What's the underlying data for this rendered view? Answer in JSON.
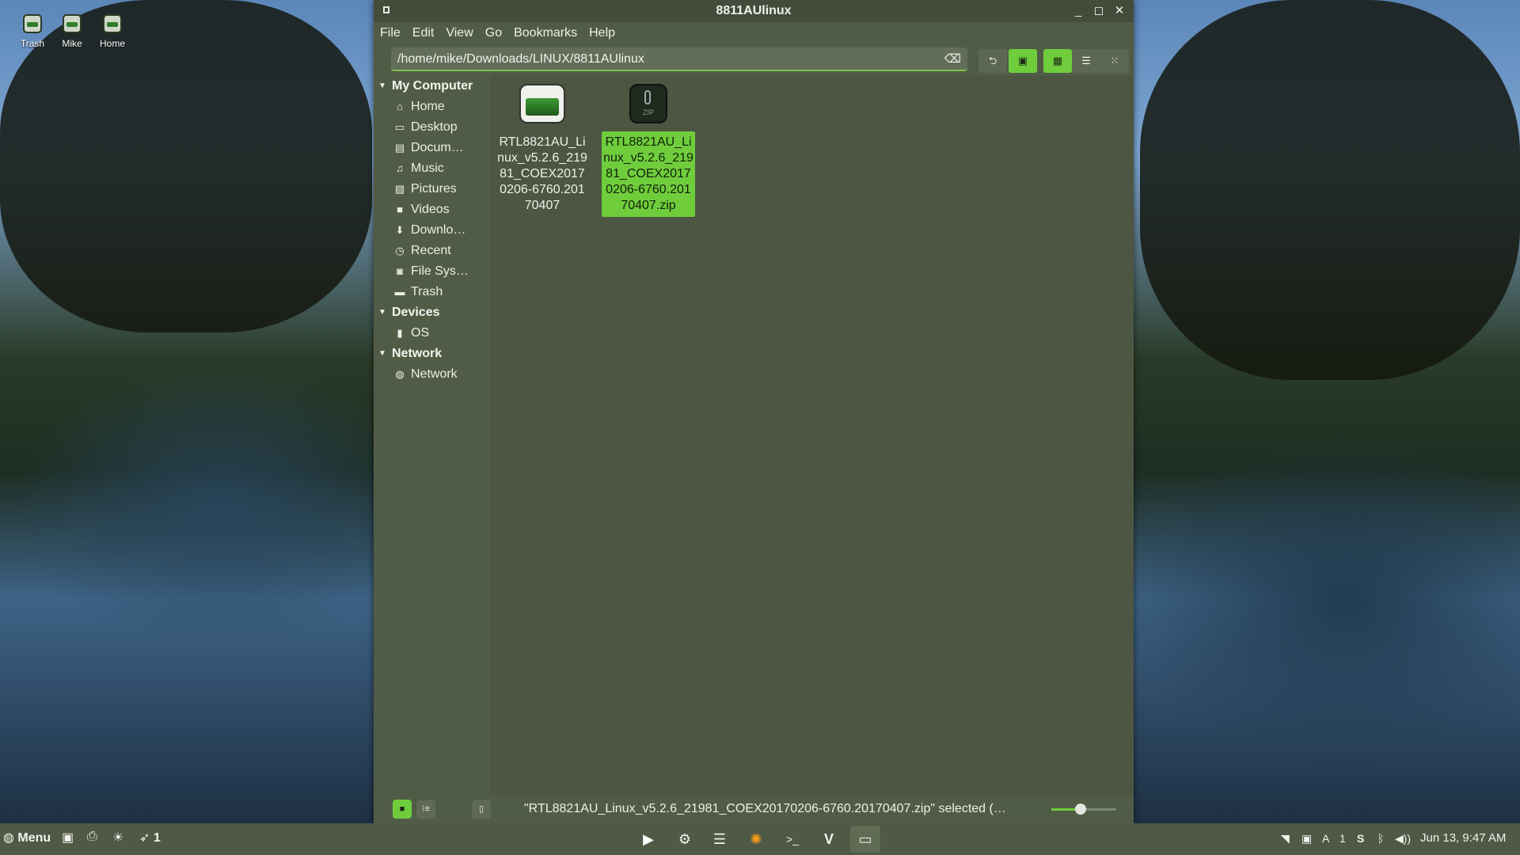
{
  "desktop": {
    "icons": [
      {
        "label": "Trash",
        "icon": "trash-icon"
      },
      {
        "label": "Mike",
        "icon": "drive-icon"
      },
      {
        "label": "Home",
        "icon": "home-folder-icon"
      }
    ]
  },
  "window": {
    "title": "8811AUlinux",
    "controls": {
      "minimize": "_",
      "maximize": "◻",
      "close": "✕"
    }
  },
  "menubar": [
    "File",
    "Edit",
    "View",
    "Go",
    "Bookmarks",
    "Help"
  ],
  "toolbar": {
    "path": "/home/mike/Downloads/LINUX/8811AUlinux",
    "buttons": [
      {
        "name": "toggle-location-icon",
        "glyph": "⮌",
        "active": false
      },
      {
        "name": "image-view-icon",
        "glyph": "▣",
        "active": true
      },
      {
        "name": "icon-view-icon",
        "glyph": "▦",
        "active": true
      },
      {
        "name": "list-view-icon",
        "glyph": "☰",
        "active": false
      },
      {
        "name": "compact-view-icon",
        "glyph": "⁙",
        "active": false
      }
    ]
  },
  "sidebar": {
    "sections": [
      {
        "title": "My Computer",
        "items": [
          {
            "label": "Home",
            "icon": "home-icon",
            "glyph": "⌂"
          },
          {
            "label": "Desktop",
            "icon": "desktop-icon",
            "glyph": "▭"
          },
          {
            "label": "Docum…",
            "icon": "document-icon",
            "glyph": "▤"
          },
          {
            "label": "Music",
            "icon": "music-icon",
            "glyph": "♫"
          },
          {
            "label": "Pictures",
            "icon": "pictures-icon",
            "glyph": "▨"
          },
          {
            "label": "Videos",
            "icon": "videos-icon",
            "glyph": "■"
          },
          {
            "label": "Downlo…",
            "icon": "download-icon",
            "glyph": "⬇"
          },
          {
            "label": "Recent",
            "icon": "recent-icon",
            "glyph": "◷"
          },
          {
            "label": "File Sys…",
            "icon": "filesystem-icon",
            "glyph": "◙"
          },
          {
            "label": "Trash",
            "icon": "trash-icon",
            "glyph": "▬"
          }
        ]
      },
      {
        "title": "Devices",
        "items": [
          {
            "label": "OS",
            "icon": "drive-icon",
            "glyph": "▮"
          }
        ]
      },
      {
        "title": "Network",
        "items": [
          {
            "label": "Network",
            "icon": "network-icon",
            "glyph": "◍"
          }
        ]
      }
    ]
  },
  "files": [
    {
      "name": "RTL8821AU_Linux_v5.2.6_21981_COEX20170206-6760.20170407",
      "type": "folder",
      "selected": false
    },
    {
      "name": "RTL8821AU_Linux_v5.2.6_21981_COEX20170206-6760.20170407.zip",
      "type": "zip",
      "selected": true,
      "badge": "ZIP"
    }
  ],
  "statusbar": {
    "text": "\"RTL8821AU_Linux_v5.2.6_21981_COEX20170206-6760.20170407.zip\" selected (…",
    "zoom": 0.45
  },
  "taskbar": {
    "menu_label": "Menu",
    "notify_count": "1",
    "apps": [
      {
        "name": "media-player-icon",
        "glyph": "▶"
      },
      {
        "name": "settings-icon",
        "glyph": "⚙"
      },
      {
        "name": "text-editor-icon",
        "glyph": "☰"
      },
      {
        "name": "firefox-icon",
        "glyph": "✺"
      },
      {
        "name": "terminal-icon",
        "glyph": ">_"
      },
      {
        "name": "vivaldi-icon",
        "glyph": "V"
      },
      {
        "name": "file-manager-icon",
        "glyph": "▭"
      }
    ],
    "clock": "Jun 13,  9:47 AM"
  }
}
